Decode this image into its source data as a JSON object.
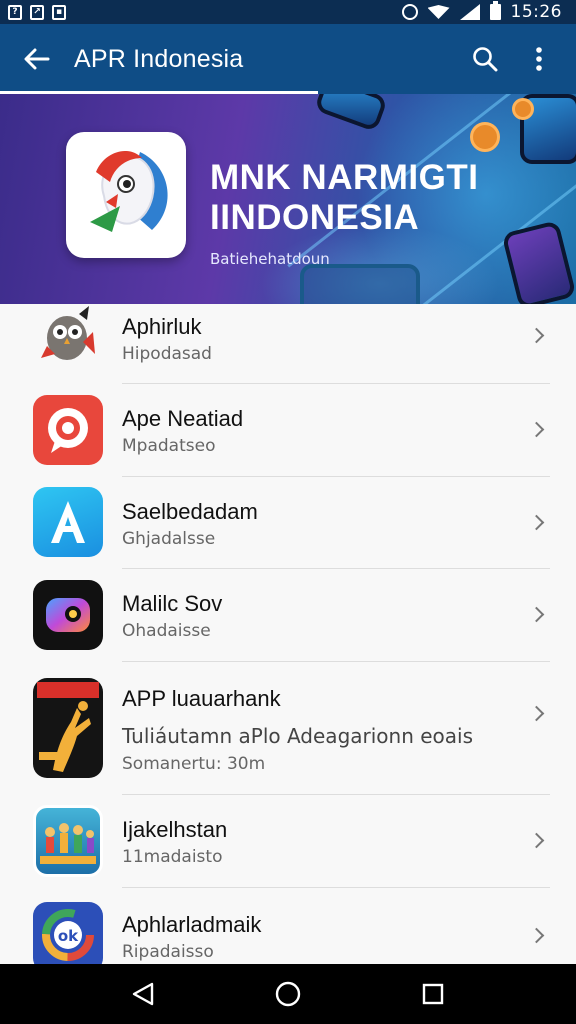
{
  "status_bar": {
    "time": "15:26",
    "icons": [
      "notification-icon",
      "image-icon",
      "save-icon",
      "alarm-icon",
      "wifi-icon",
      "signal-icon",
      "battery-icon"
    ]
  },
  "app_bar": {
    "title": "APR Indonesia",
    "back_icon": "arrow-back-icon",
    "search_icon": "search-icon",
    "more_icon": "more-vert-icon",
    "color": "#0f4d86"
  },
  "banner": {
    "title_line1": "MNK NARMIGTI",
    "title_line2": "IINDONESIA",
    "subtitle": "Batiehehatdoun"
  },
  "apps": [
    {
      "name": "Aphirluk",
      "subtitle": "Hipodasad"
    },
    {
      "name": "Ape Neatiad",
      "subtitle": "Mpadatseo"
    },
    {
      "name": "Saelbedadam",
      "subtitle": "Ghjadalsse"
    },
    {
      "name": "Malilc Sov",
      "subtitle": "Ohadaisse"
    },
    {
      "name": "APP luauarhank",
      "subtitle": "Tuliáutamn aPlo Adeagarionn eoais",
      "meta": "Somanertu: 30m"
    },
    {
      "name": "Ijakelhstan",
      "subtitle": "11madaisto"
    },
    {
      "name": "Aphlarladmaik",
      "subtitle": "Ripadaisso"
    }
  ],
  "nav_bar": {
    "back": "nav-back-icon",
    "home": "nav-home-icon",
    "recents": "nav-recents-icon"
  }
}
